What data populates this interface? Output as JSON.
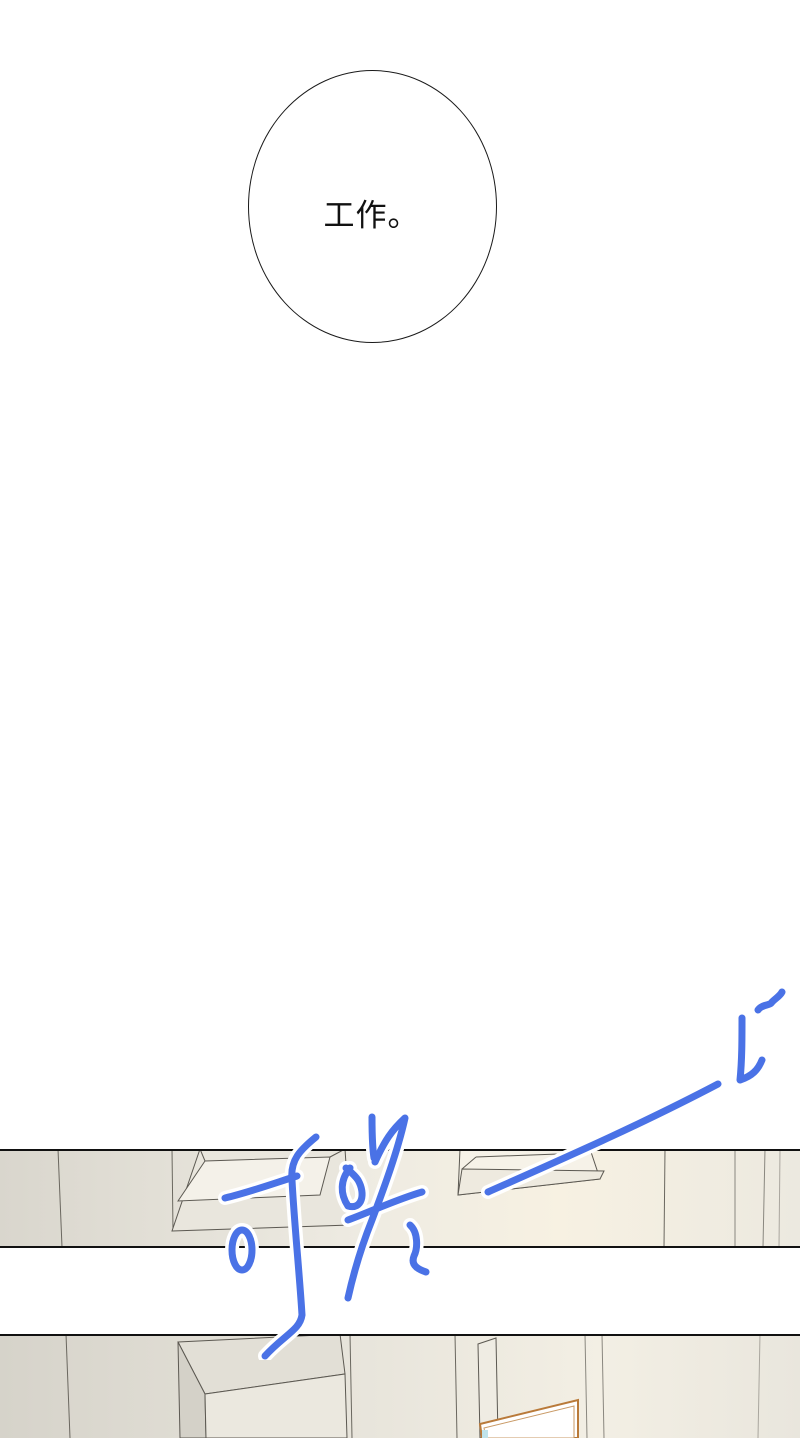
{
  "speech_bubble": {
    "text": "工作。"
  },
  "sfx": {
    "text": "이야~",
    "color": "#4a72e6"
  },
  "colors": {
    "wall": "#e4e1d8",
    "wall_light": "#f3efe4",
    "line": "#5a5852",
    "panel_border": "#111111",
    "door_frame": "#b97a3a"
  }
}
